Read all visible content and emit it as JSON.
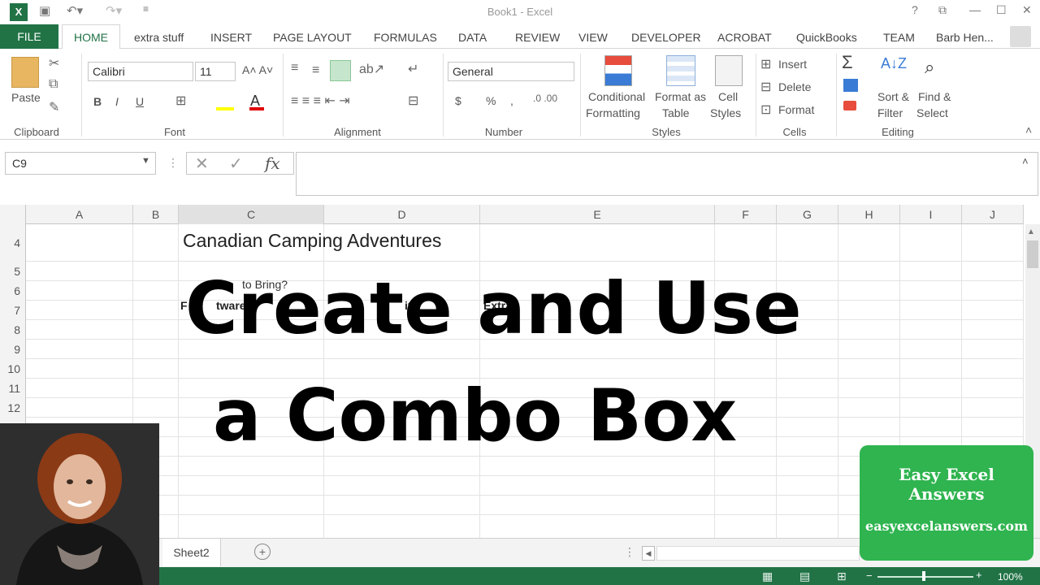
{
  "window": {
    "title": "Book1 - Excel",
    "user": "Barb Hen..."
  },
  "ribbon_tabs": [
    "FILE",
    "HOME",
    "extra stuff",
    "INSERT",
    "PAGE LAYOUT",
    "FORMULAS",
    "DATA",
    "REVIEW",
    "VIEW",
    "DEVELOPER",
    "ACROBAT",
    "QuickBooks",
    "TEAM"
  ],
  "clipboard": {
    "paste": "Paste",
    "group": "Clipboard"
  },
  "font": {
    "name": "Calibri",
    "size": "11",
    "bold": "B",
    "italic": "I",
    "underline": "U",
    "group": "Font"
  },
  "alignment": {
    "group": "Alignment"
  },
  "number": {
    "format": "General",
    "currency": "$",
    "percent": "%",
    "comma": ",",
    "group": "Number"
  },
  "styles": {
    "conditional": "Conditional",
    "formatting": "Formatting",
    "format_as": "Format as",
    "table": "Table",
    "cell": "Cell",
    "styles": "Styles",
    "group": "Styles"
  },
  "cells": {
    "insert": "Insert",
    "delete": "Delete",
    "format": "Format",
    "group": "Cells"
  },
  "editing": {
    "sum": "Σ",
    "sort": "Sort &",
    "filter": "Filter",
    "find": "Find &",
    "select": "Select",
    "group": "Editing"
  },
  "formula_bar": {
    "name_box": "C9",
    "cancel": "✕",
    "enter": "✓",
    "fx": "fx",
    "value": ""
  },
  "columns": [
    "A",
    "B",
    "C",
    "D",
    "E",
    "F",
    "G",
    "H",
    "I",
    "J"
  ],
  "rows": [
    "4",
    "5",
    "6",
    "7",
    "8",
    "9",
    "10",
    "11",
    "12"
  ],
  "cells_content": {
    "c4": "Canadian Camping Adventures",
    "c6": "to Bring?",
    "c7": "F",
    "c7b": "tware",
    "d7": "ith",
    "e7": "Extra"
  },
  "overlay": {
    "line1": "Create and Use",
    "line2": "a Combo Box"
  },
  "sheet_tabs": [
    "Sheet2"
  ],
  "status": {
    "zoom": "100%"
  },
  "badge": {
    "title": "Easy Excel Answers",
    "url": "easyexcelanswers.com"
  },
  "colors": {
    "excel_green": "#217346",
    "badge_green": "#2fb44f"
  }
}
